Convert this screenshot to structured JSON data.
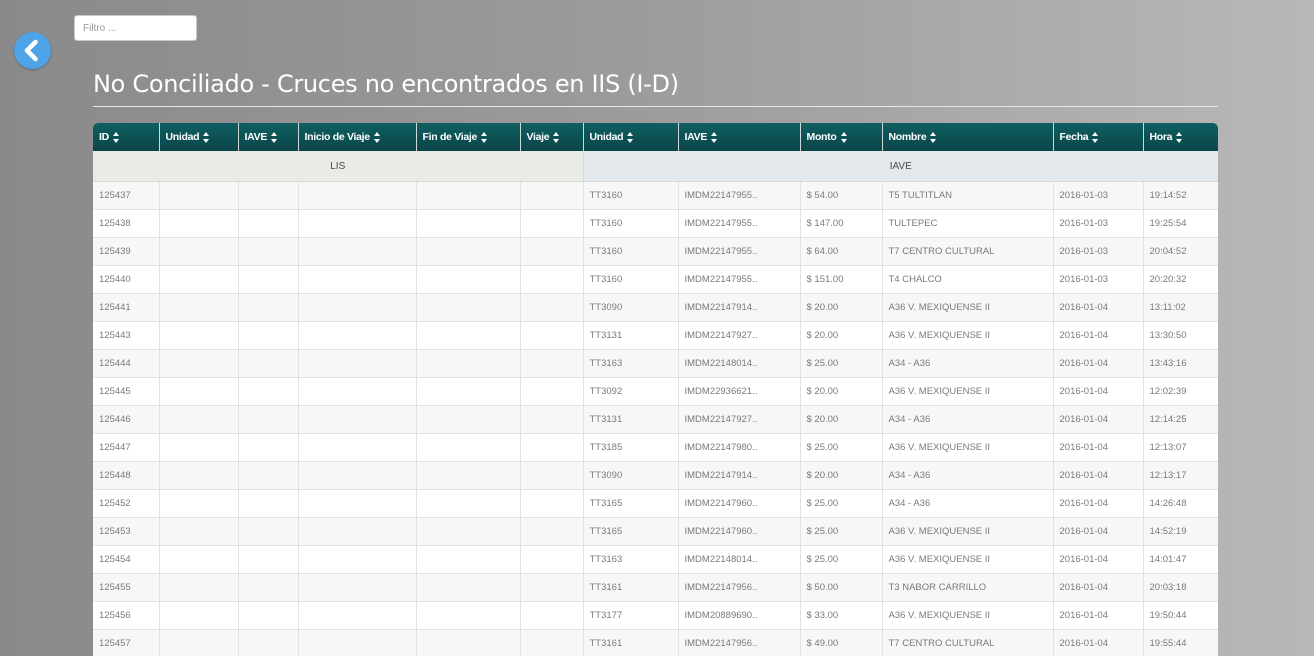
{
  "filter": {
    "placeholder": "Filtro ..."
  },
  "page": {
    "title": "No Conciliado - Cruces no encontrados en IIS (I-D)"
  },
  "table": {
    "headers": [
      "ID",
      "Unidad",
      "IAVE",
      "Inicio de Viaje",
      "Fin de Viaje",
      "Viaje",
      "Unidad",
      "IAVE",
      "Monto",
      "Nombre",
      "Fecha",
      "Hora"
    ],
    "groups": {
      "lis": "LIS",
      "iave": "IAVE"
    },
    "rows": [
      [
        "125437",
        "",
        "",
        "",
        "",
        "",
        "TT3160",
        "IMDM22147955..",
        "$ 54.00",
        "T5 TULTITLAN",
        "2016-01-03",
        "19:14:52"
      ],
      [
        "125438",
        "",
        "",
        "",
        "",
        "",
        "TT3160",
        "IMDM22147955..",
        "$ 147.00",
        "TULTEPEC",
        "2016-01-03",
        "19:25:54"
      ],
      [
        "125439",
        "",
        "",
        "",
        "",
        "",
        "TT3160",
        "IMDM22147955..",
        "$ 64.00",
        "T7 CENTRO CULTURAL",
        "2016-01-03",
        "20:04:52"
      ],
      [
        "125440",
        "",
        "",
        "",
        "",
        "",
        "TT3160",
        "IMDM22147955..",
        "$ 151.00",
        "T4 CHALCO",
        "2016-01-03",
        "20:20:32"
      ],
      [
        "125441",
        "",
        "",
        "",
        "",
        "",
        "TT3090",
        "IMDM22147914..",
        "$ 20.00",
        "A36 V. MEXIQUENSE II",
        "2016-01-04",
        "13:11:02"
      ],
      [
        "125443",
        "",
        "",
        "",
        "",
        "",
        "TT3131",
        "IMDM22147927..",
        "$ 20.00",
        "A36 V. MEXIQUENSE II",
        "2016-01-04",
        "13:30:50"
      ],
      [
        "125444",
        "",
        "",
        "",
        "",
        "",
        "TT3163",
        "IMDM22148014..",
        "$ 25.00",
        "A34 - A36",
        "2016-01-04",
        "13:43:16"
      ],
      [
        "125445",
        "",
        "",
        "",
        "",
        "",
        "TT3092",
        "IMDM22936621..",
        "$ 20.00",
        "A36 V. MEXIQUENSE II",
        "2016-01-04",
        "12:02:39"
      ],
      [
        "125446",
        "",
        "",
        "",
        "",
        "",
        "TT3131",
        "IMDM22147927..",
        "$ 20.00",
        "A34 - A36",
        "2016-01-04",
        "12:14:25"
      ],
      [
        "125447",
        "",
        "",
        "",
        "",
        "",
        "TT3185",
        "IMDM22147980..",
        "$ 25.00",
        "A36 V. MEXIQUENSE II",
        "2016-01-04",
        "12:13:07"
      ],
      [
        "125448",
        "",
        "",
        "",
        "",
        "",
        "TT3090",
        "IMDM22147914..",
        "$ 20.00",
        "A34 - A36",
        "2016-01-04",
        "12:13:17"
      ],
      [
        "125452",
        "",
        "",
        "",
        "",
        "",
        "TT3165",
        "IMDM22147960..",
        "$ 25.00",
        "A34 - A36",
        "2016-01-04",
        "14:26:48"
      ],
      [
        "125453",
        "",
        "",
        "",
        "",
        "",
        "TT3165",
        "IMDM22147960..",
        "$ 25.00",
        "A36 V. MEXIQUENSE II",
        "2016-01-04",
        "14:52:19"
      ],
      [
        "125454",
        "",
        "",
        "",
        "",
        "",
        "TT3163",
        "IMDM22148014..",
        "$ 25.00",
        "A36 V. MEXIQUENSE II",
        "2016-01-04",
        "14:01:47"
      ],
      [
        "125455",
        "",
        "",
        "",
        "",
        "",
        "TT3161",
        "IMDM22147956..",
        "$ 50.00",
        "T3 NABOR CARRILLO",
        "2016-01-04",
        "20:03:18"
      ],
      [
        "125456",
        "",
        "",
        "",
        "",
        "",
        "TT3177",
        "IMDM20889690..",
        "$ 33.00",
        "A36 V. MEXIQUENSE II",
        "2016-01-04",
        "19:50:44"
      ],
      [
        "125457",
        "",
        "",
        "",
        "",
        "",
        "TT3161",
        "IMDM22147956..",
        "$ 49.00",
        "T7 CENTRO CULTURAL",
        "2016-01-04",
        "19:55:44"
      ]
    ]
  },
  "icons": {
    "back": "chevron-left-icon",
    "sort": "sort-icon"
  },
  "colors": {
    "header_bg": "#0a4548",
    "back_button": "#4fa3e8",
    "group_lis_bg": "#e8ebe6",
    "group_iave_bg": "#e2e8ec"
  }
}
